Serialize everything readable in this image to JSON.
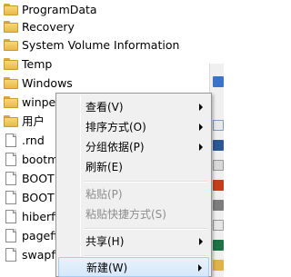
{
  "file_list": {
    "items": [
      {
        "name": "ProgramData",
        "icon": "folder-icon"
      },
      {
        "name": "Recovery",
        "icon": "folder-icon"
      },
      {
        "name": "System Volume Information",
        "icon": "folder-icon"
      },
      {
        "name": "Temp",
        "icon": "folder-icon"
      },
      {
        "name": "Windows",
        "icon": "folder-icon"
      },
      {
        "name": "winpe_",
        "icon": "folder-icon"
      },
      {
        "name": "用户",
        "icon": "folder-icon"
      },
      {
        "name": ".rnd",
        "icon": "file-icon"
      },
      {
        "name": "bootm",
        "icon": "file-icon"
      },
      {
        "name": "BOOT",
        "icon": "file-icon"
      },
      {
        "name": "BOOT",
        "icon": "file-icon"
      },
      {
        "name": "hiberfi",
        "icon": "file-icon"
      },
      {
        "name": "pagefi",
        "icon": "file-icon"
      },
      {
        "name": "swapfi",
        "icon": "file-icon"
      }
    ]
  },
  "context_menu": {
    "view": "查看(V)",
    "sort_by": "排序方式(O)",
    "group_by": "分组依据(P)",
    "refresh": "刷新(E)",
    "paste": "粘贴(P)",
    "paste_shortcut": "粘贴快捷方式(S)",
    "share_with": "共享(H)",
    "new": "新建(W)"
  },
  "colors": {
    "menu_bg": "#f0f0f0",
    "highlight": "#d6e8fa",
    "folder": "#f7d778"
  }
}
